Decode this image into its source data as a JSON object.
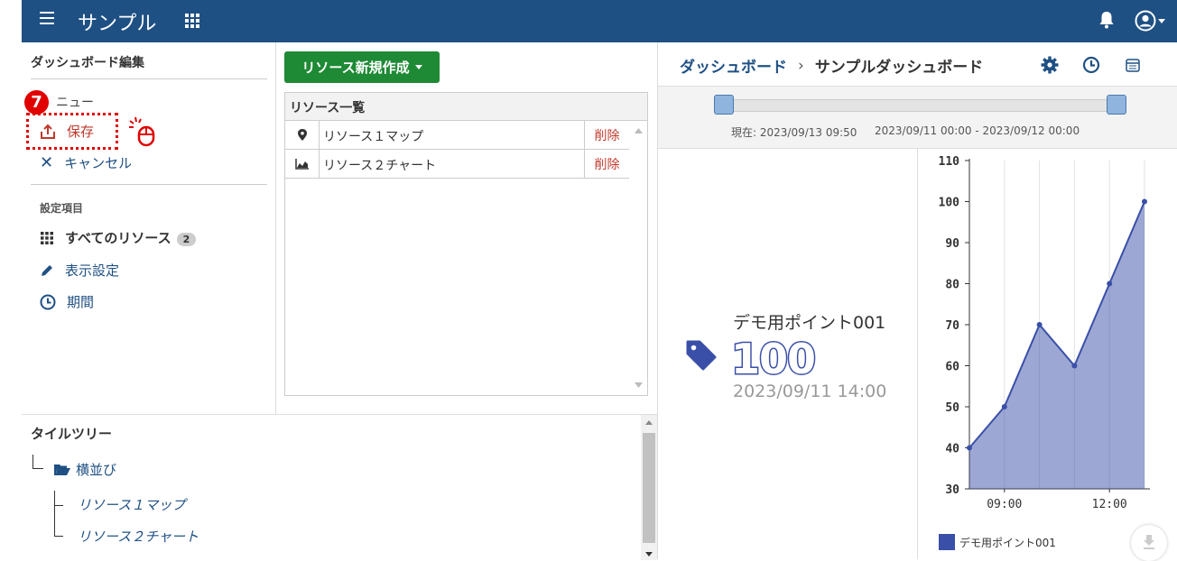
{
  "header": {
    "title": "サンプル"
  },
  "left": {
    "title": "ダッシュボード編集",
    "menu_label": "ニュー",
    "save_label": "保存",
    "cancel_label": "キャンセル",
    "settings_head": "設定項目",
    "all_resources_label": "すべてのリソース",
    "all_resources_count": "2",
    "display_label": "表示設定",
    "period_label": "期間"
  },
  "middle": {
    "create_label": "リソース新規作成",
    "list_title": "リソース一覧",
    "rows": [
      {
        "name": "リソース１マップ",
        "icon": "map-marker-icon",
        "action": "削除"
      },
      {
        "name": "リソース２チャート",
        "icon": "area-chart-icon",
        "action": "削除"
      }
    ]
  },
  "tree": {
    "title": "タイルツリー",
    "folder": "横並び",
    "items": [
      "リソース１マップ",
      "リソース２チャート"
    ]
  },
  "right": {
    "breadcrumb_link": "ダッシュボード",
    "breadcrumb_sep": "›",
    "breadcrumb_current": "サンプルダッシュボード",
    "now_text": "現在: 2023/09/13 09:50",
    "range_text": "2023/09/11 00:00 - 2023/09/12 00:00"
  },
  "tile": {
    "name": "デモ用ポイント001",
    "value": "100",
    "time": "2023/09/11 14:00"
  },
  "annotation": {
    "step": "7"
  },
  "colors": {
    "header": "#1f5084",
    "accent": "#1e8a35",
    "series": "#3a4fa8",
    "danger": "#c0392b",
    "annotation": "#e00000"
  },
  "chart_data": {
    "type": "area",
    "x": [
      "08:00",
      "09:00",
      "10:00",
      "11:00",
      "12:00",
      "13:00"
    ],
    "x_tick_labels": [
      "09:00",
      "12:00"
    ],
    "series": [
      {
        "name": "デモ用ポイント001",
        "values": [
          40,
          50,
          70,
          60,
          80,
          100
        ]
      }
    ],
    "ylim": [
      30,
      110
    ],
    "y_ticks": [
      30,
      40,
      50,
      60,
      70,
      80,
      90,
      100,
      110
    ],
    "grid": "vertical",
    "legend": "bottom-left"
  }
}
